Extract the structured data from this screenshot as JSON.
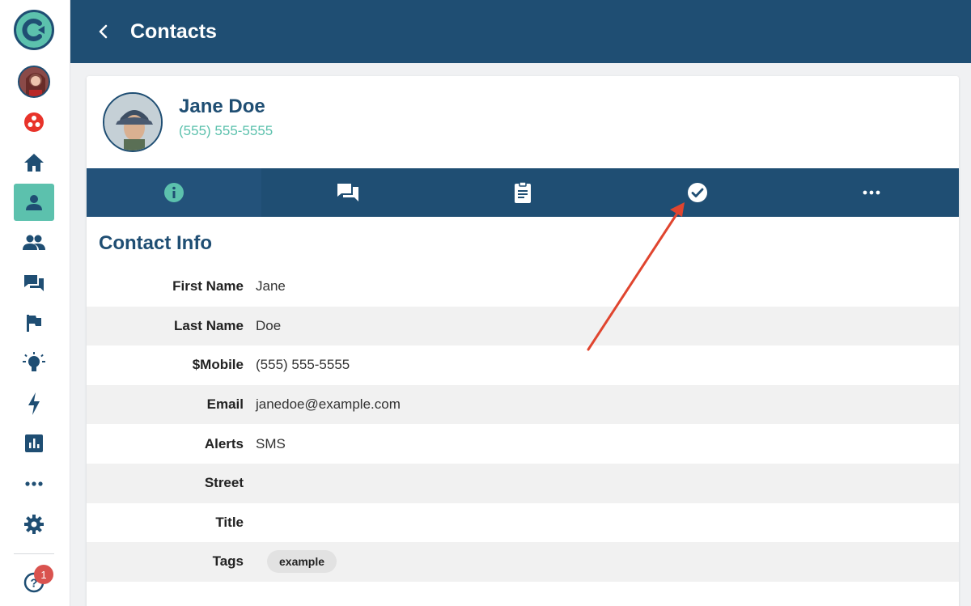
{
  "header": {
    "title": "Contacts",
    "back_icon": "chevron-left-icon"
  },
  "sidebar": {
    "logo_icon": "app-logo-icon",
    "items": [
      {
        "name": "user-avatar"
      },
      {
        "name": "circles-icon"
      },
      {
        "name": "home-icon"
      },
      {
        "name": "contact-icon",
        "active": true
      },
      {
        "name": "group-icon"
      },
      {
        "name": "chat-icon"
      },
      {
        "name": "flag-icon"
      },
      {
        "name": "lightbulb-icon"
      },
      {
        "name": "bolt-icon"
      },
      {
        "name": "bar-chart-icon"
      },
      {
        "name": "more-icon"
      },
      {
        "name": "settings-icon"
      },
      {
        "name": "help-icon"
      }
    ],
    "help_badge": "1"
  },
  "contact": {
    "name": "Jane Doe",
    "phone": "(555) 555-5555"
  },
  "tabs": [
    {
      "icon": "info-icon",
      "active": true
    },
    {
      "icon": "chat-icon"
    },
    {
      "icon": "clipboard-icon"
    },
    {
      "icon": "check-circle-icon"
    },
    {
      "icon": "more-icon"
    }
  ],
  "section": {
    "title": "Contact Info"
  },
  "fields": [
    {
      "label": "First Name",
      "value": "Jane"
    },
    {
      "label": "Last Name",
      "value": "Doe"
    },
    {
      "label": "$Mobile",
      "value": "(555) 555-5555"
    },
    {
      "label": "Email",
      "value": "janedoe@example.com"
    },
    {
      "label": "Alerts",
      "value": "SMS"
    },
    {
      "label": "Street",
      "value": ""
    },
    {
      "label": "Title",
      "value": ""
    },
    {
      "label": "Tags",
      "tag": "example"
    }
  ],
  "colors": {
    "primary": "#1f4e73",
    "accent": "#5cc1ad",
    "alert_red": "#d9534f",
    "annotation_arrow": "#e0452f"
  }
}
